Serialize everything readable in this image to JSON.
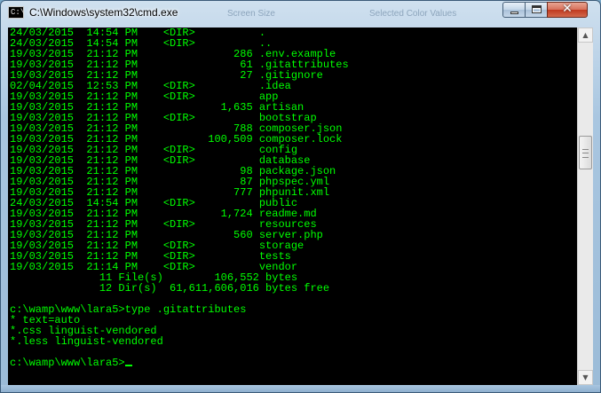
{
  "window": {
    "title": "C:\\Windows\\system32\\cmd.exe",
    "icon_label": "C:\\",
    "ghost_texts": [
      "Screen Size",
      "Selected Color Values"
    ]
  },
  "controls": {
    "minimize_icon": "minimize-icon",
    "maximize_icon": "maximize-icon",
    "close_glyph": "✕"
  },
  "console": {
    "lines": [
      "24/03/2015  14:54 PM    <DIR>          .",
      "24/03/2015  14:54 PM    <DIR>          ..",
      "19/03/2015  21:12 PM               286 .env.example",
      "19/03/2015  21:12 PM                61 .gitattributes",
      "19/03/2015  21:12 PM                27 .gitignore",
      "02/04/2015  12:53 PM    <DIR>          .idea",
      "19/03/2015  21:12 PM    <DIR>          app",
      "19/03/2015  21:12 PM             1,635 artisan",
      "19/03/2015  21:12 PM    <DIR>          bootstrap",
      "19/03/2015  21:12 PM               788 composer.json",
      "19/03/2015  21:12 PM           100,509 composer.lock",
      "19/03/2015  21:12 PM    <DIR>          config",
      "19/03/2015  21:12 PM    <DIR>          database",
      "19/03/2015  21:12 PM                98 package.json",
      "19/03/2015  21:12 PM                87 phpspec.yml",
      "19/03/2015  21:12 PM               777 phpunit.xml",
      "24/03/2015  14:54 PM    <DIR>          public",
      "19/03/2015  21:12 PM             1,724 readme.md",
      "19/03/2015  21:12 PM    <DIR>          resources",
      "19/03/2015  21:12 PM               560 server.php",
      "19/03/2015  21:12 PM    <DIR>          storage",
      "19/03/2015  21:12 PM    <DIR>          tests",
      "19/03/2015  21:14 PM    <DIR>          vendor",
      "              11 File(s)        106,552 bytes",
      "              12 Dir(s)  61,611,606,016 bytes free",
      "",
      "c:\\wamp\\www\\lara5>type .gitattributes",
      "* text=auto",
      "*.css linguist-vendored",
      "*.less linguist-vendored",
      "",
      "c:\\wamp\\www\\lara5>"
    ],
    "text_color": "#00ff00",
    "background_color": "#000000"
  },
  "scrollbar": {
    "up_glyph": "▲",
    "down_glyph": "▼"
  }
}
